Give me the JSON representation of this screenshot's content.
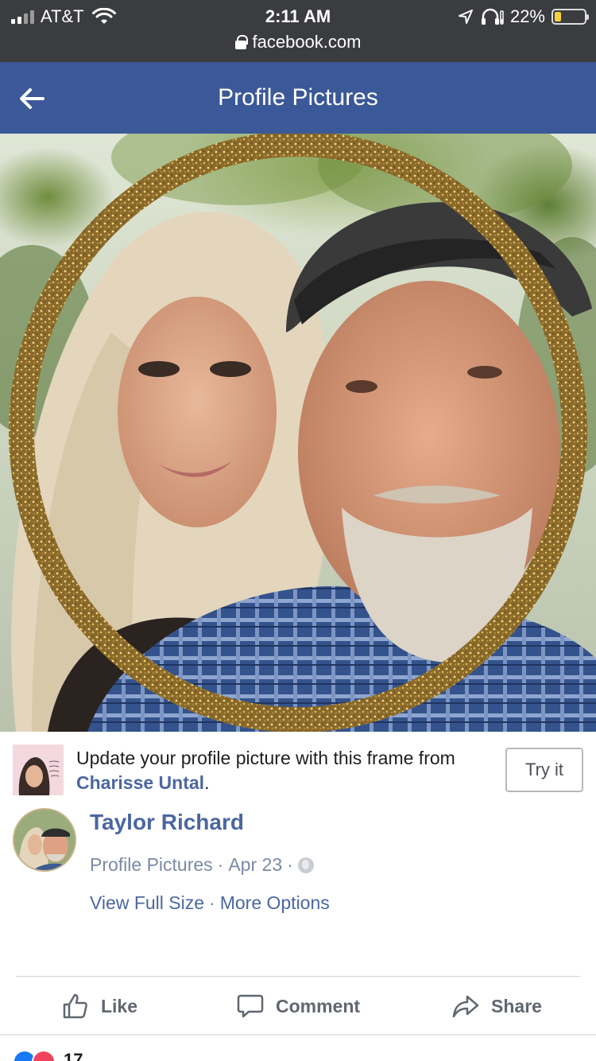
{
  "status_bar": {
    "carrier": "AT&T",
    "time": "2:11 AM",
    "battery_percent": "22%",
    "battery_level": 0.22,
    "url": "facebook.com"
  },
  "nav": {
    "title": "Profile Pictures"
  },
  "frame_banner": {
    "text": "Update your profile picture with this frame from",
    "author": "Charisse Untal",
    "punct": ".",
    "button": "Try it"
  },
  "post": {
    "poster": "Taylor Richard",
    "album": "Profile Pictures",
    "date": "Apr 23",
    "separator": "·",
    "link_full": "View Full Size",
    "link_more": "More Options"
  },
  "actions": {
    "like": "Like",
    "comment": "Comment",
    "share": "Share"
  },
  "reactions": {
    "count": "17"
  },
  "colors": {
    "nav": "#3b5998",
    "link": "#4b67a1",
    "status_bar": "#3b3c3f"
  }
}
